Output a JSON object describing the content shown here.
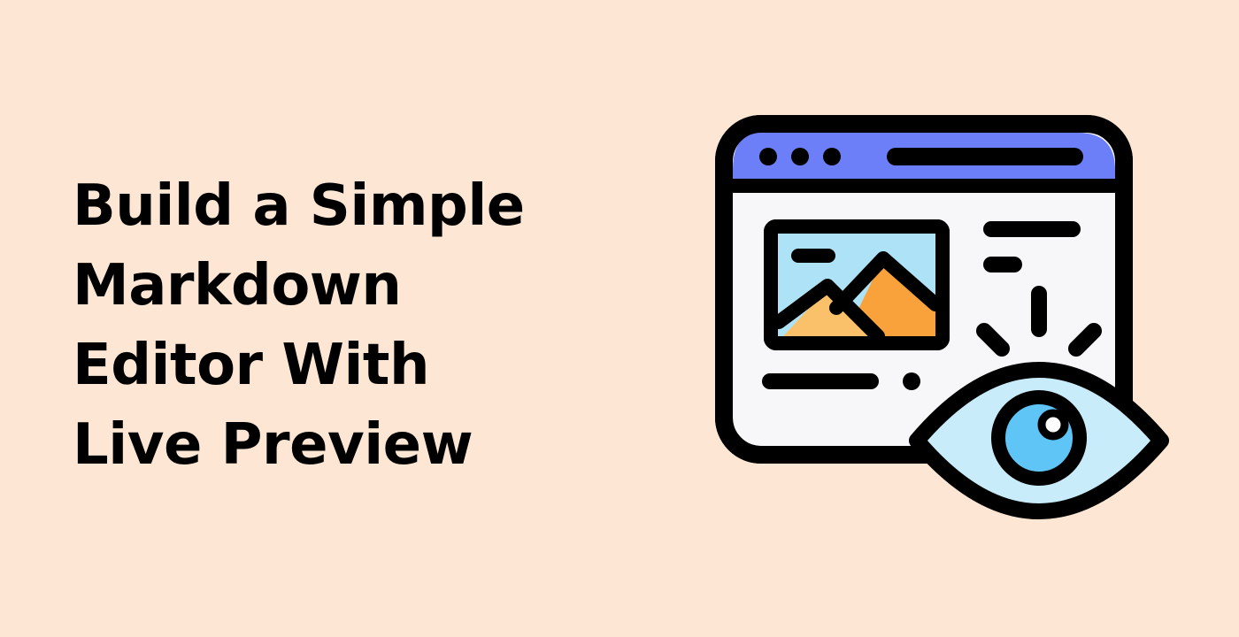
{
  "title_lines": [
    "Build a Simple",
    "Markdown",
    "Editor With",
    "Live Preview"
  ],
  "colors": {
    "background": "#fde6d3",
    "browser_bar": "#6c7ff8",
    "window_body": "#f7f7fa",
    "image_sky": "#aee2f7",
    "mountain_large": "#f9a23c",
    "mountain_small": "#fbc16a",
    "eye_white": "#c9ecfb",
    "iris": "#5fc4f6",
    "outline": "#000000"
  },
  "icons": {
    "illustration": "browser-window-preview-icon",
    "image": "image-placeholder-icon",
    "eye": "eye-icon"
  }
}
